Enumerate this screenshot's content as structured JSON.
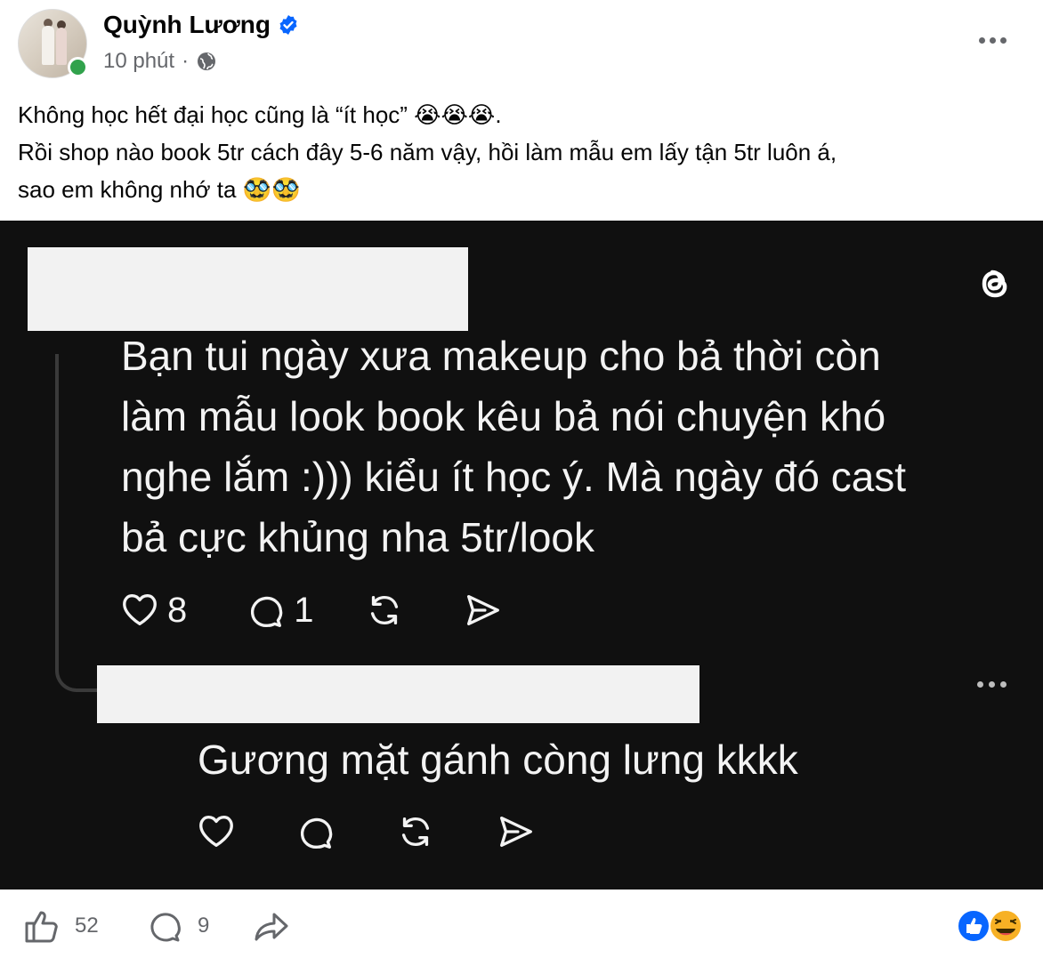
{
  "post": {
    "author": "Quỳnh Lương",
    "time": "10 phút",
    "separator": "·",
    "caption_lines": [
      "Không học hết đại học cũng là “ít học” 😭😭😭.",
      "Rồi shop nào book 5tr cách đây 5-6 năm vậy, hồi làm mẫu em lấy tận 5tr luôn á,",
      "sao em không nhớ ta 🥸🥸"
    ]
  },
  "screenshot": {
    "comment1_lines": [
      "Bạn tui ngày xưa makeup cho bả thời còn",
      "làm mẫu look book kêu bả nói chuyện khó",
      "nghe lắm :))) kiểu ít học ý. Mà ngày đó cast",
      "bả cực khủng nha 5tr/look"
    ],
    "comment1_likes": "8",
    "comment1_replies": "1",
    "comment2_text": "Gương mặt gánh còng lưng kkkk"
  },
  "footer": {
    "likes": "52",
    "comments": "9"
  },
  "colors": {
    "brand_blue": "#0866ff",
    "online_green": "#31a24c",
    "dark_bg": "#101010",
    "secondary_text": "#65676b"
  },
  "icons": [
    "verified-icon",
    "globe-icon",
    "more-icon",
    "threads-logo-icon",
    "heart-icon",
    "comment-icon",
    "repost-icon",
    "share-icon",
    "like-icon",
    "haha-icon"
  ]
}
